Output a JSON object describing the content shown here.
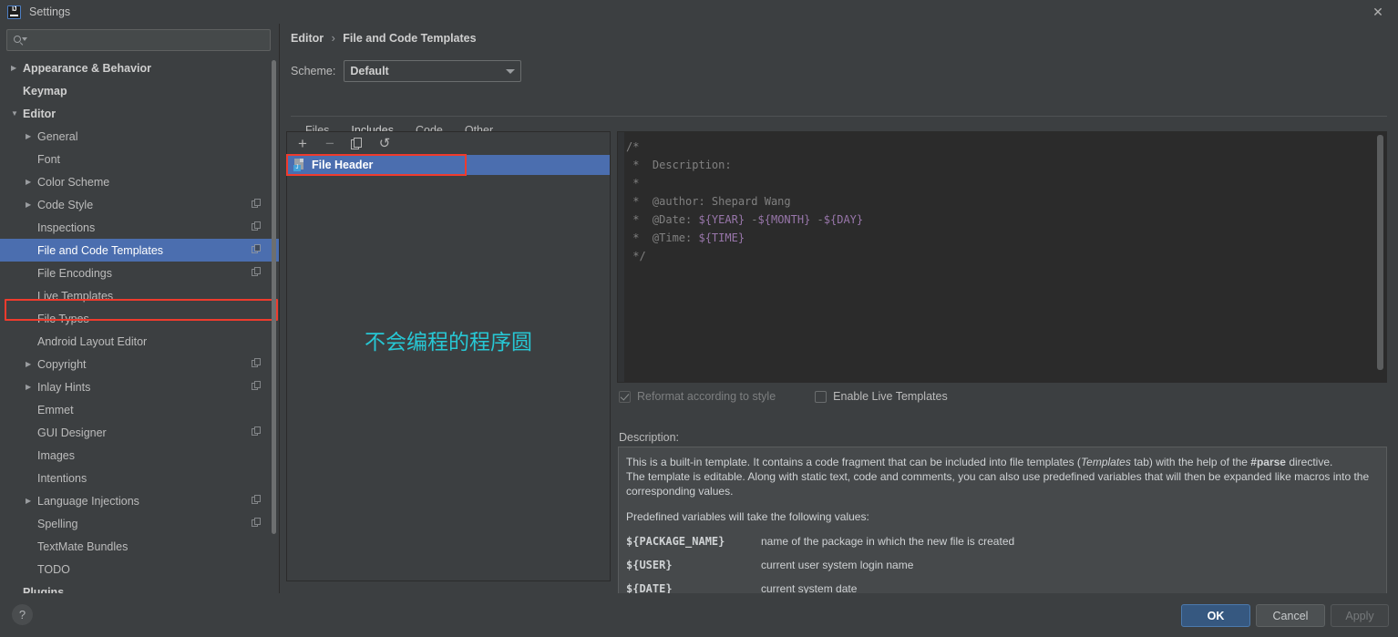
{
  "window": {
    "title": "Settings",
    "app_icon": "intellij-idea-logo",
    "close_icon": "close-icon"
  },
  "search": {
    "value": "",
    "placeholder": "",
    "icon": "search-icon"
  },
  "sidebar": {
    "items": [
      {
        "label": "Appearance & Behavior",
        "depth": 1,
        "arrow": "▶",
        "bold": true,
        "badge": false,
        "selected": false
      },
      {
        "label": "Keymap",
        "depth": 1,
        "arrow": "",
        "bold": true,
        "badge": false,
        "selected": false
      },
      {
        "label": "Editor",
        "depth": 1,
        "arrow": "▼",
        "bold": true,
        "badge": false,
        "selected": false
      },
      {
        "label": "General",
        "depth": 2,
        "arrow": "▶",
        "bold": false,
        "badge": false,
        "selected": false
      },
      {
        "label": "Font",
        "depth": 2,
        "arrow": "",
        "bold": false,
        "badge": false,
        "selected": false
      },
      {
        "label": "Color Scheme",
        "depth": 2,
        "arrow": "▶",
        "bold": false,
        "badge": false,
        "selected": false
      },
      {
        "label": "Code Style",
        "depth": 2,
        "arrow": "▶",
        "bold": false,
        "badge": true,
        "selected": false
      },
      {
        "label": "Inspections",
        "depth": 2,
        "arrow": "",
        "bold": false,
        "badge": true,
        "selected": false
      },
      {
        "label": "File and Code Templates",
        "depth": 2,
        "arrow": "",
        "bold": false,
        "badge": true,
        "selected": true
      },
      {
        "label": "File Encodings",
        "depth": 2,
        "arrow": "",
        "bold": false,
        "badge": true,
        "selected": false
      },
      {
        "label": "Live Templates",
        "depth": 2,
        "arrow": "",
        "bold": false,
        "badge": false,
        "selected": false
      },
      {
        "label": "File Types",
        "depth": 2,
        "arrow": "",
        "bold": false,
        "badge": false,
        "selected": false
      },
      {
        "label": "Android Layout Editor",
        "depth": 2,
        "arrow": "",
        "bold": false,
        "badge": false,
        "selected": false
      },
      {
        "label": "Copyright",
        "depth": 2,
        "arrow": "▶",
        "bold": false,
        "badge": true,
        "selected": false
      },
      {
        "label": "Inlay Hints",
        "depth": 2,
        "arrow": "▶",
        "bold": false,
        "badge": true,
        "selected": false
      },
      {
        "label": "Emmet",
        "depth": 2,
        "arrow": "",
        "bold": false,
        "badge": false,
        "selected": false
      },
      {
        "label": "GUI Designer",
        "depth": 2,
        "arrow": "",
        "bold": false,
        "badge": true,
        "selected": false
      },
      {
        "label": "Images",
        "depth": 2,
        "arrow": "",
        "bold": false,
        "badge": false,
        "selected": false
      },
      {
        "label": "Intentions",
        "depth": 2,
        "arrow": "",
        "bold": false,
        "badge": false,
        "selected": false
      },
      {
        "label": "Language Injections",
        "depth": 2,
        "arrow": "▶",
        "bold": false,
        "badge": true,
        "selected": false
      },
      {
        "label": "Spelling",
        "depth": 2,
        "arrow": "",
        "bold": false,
        "badge": true,
        "selected": false
      },
      {
        "label": "TextMate Bundles",
        "depth": 2,
        "arrow": "",
        "bold": false,
        "badge": false,
        "selected": false
      },
      {
        "label": "TODO",
        "depth": 2,
        "arrow": "",
        "bold": false,
        "badge": false,
        "selected": false
      },
      {
        "label": "Plugins",
        "depth": 1,
        "arrow": "",
        "bold": true,
        "badge": false,
        "selected": false
      }
    ],
    "highlight_color": "#ef3b2d",
    "selection_color": "#4b6eaf"
  },
  "breadcrumb": {
    "root": "Editor",
    "separator": "›",
    "current": "File and Code Templates"
  },
  "scheme": {
    "label": "Scheme:",
    "value": "Default",
    "dropdown_icon": "chevron-down-icon"
  },
  "tabs": [
    {
      "label": "Files",
      "active": false
    },
    {
      "label": "Includes",
      "active": true
    },
    {
      "label": "Code",
      "active": false
    },
    {
      "label": "Other",
      "active": false
    }
  ],
  "list_panel": {
    "toolbar": {
      "add_icon": "plus-icon",
      "remove_icon": "minus-icon",
      "copy_icon": "copy-icon",
      "reset_icon": "undo-icon"
    },
    "items": [
      {
        "label": "File Header",
        "icon": "java-file-icon",
        "selected": true
      }
    ],
    "watermark": "不会编程的程序圆",
    "watermark_color": "#27c7d4"
  },
  "editor": {
    "lines": [
      {
        "text": "/*",
        "type": "comment"
      },
      {
        "text": " *  Description:",
        "type": "comment"
      },
      {
        "text": " *",
        "type": "comment"
      },
      {
        "text": " *  @author: Shepard Wang",
        "type": "comment"
      },
      {
        "text": " *  @Date: ${YEAR} -${MONTH} -${DAY}",
        "type": "comment_with_vars"
      },
      {
        "text": " *  @Time: ${TIME}",
        "type": "comment_with_vars"
      },
      {
        "text": " */",
        "type": "comment"
      }
    ],
    "comment_color": "#808080",
    "variable_color": "#9876aa",
    "background": "#2b2b2b"
  },
  "options": {
    "reformat": {
      "label": "Reformat according to style",
      "checked": true,
      "disabled": true
    },
    "live_templates": {
      "label": "Enable Live Templates",
      "checked": false,
      "disabled": false
    }
  },
  "description": {
    "label": "Description:",
    "paragraph1_pre": "This is a built-in template. It contains a code fragment that can be included into file templates (",
    "paragraph1_italic": "Templates",
    "paragraph1_mid": " tab) with the help of the ",
    "paragraph1_bold": "#parse",
    "paragraph1_post": " directive.",
    "paragraph2": "The template is editable. Along with static text, code and comments, you can also use predefined variables that will then be expanded like macros into the corresponding values.",
    "paragraph3": "Predefined variables will take the following values:",
    "variables": [
      {
        "name": "${PACKAGE_NAME}",
        "meaning": "name of the package in which the new file is created"
      },
      {
        "name": "${USER}",
        "meaning": "current user system login name"
      },
      {
        "name": "${DATE}",
        "meaning": "current system date"
      }
    ]
  },
  "footer": {
    "help_label": "?",
    "ok": "OK",
    "cancel": "Cancel",
    "apply": "Apply",
    "apply_disabled": true
  }
}
